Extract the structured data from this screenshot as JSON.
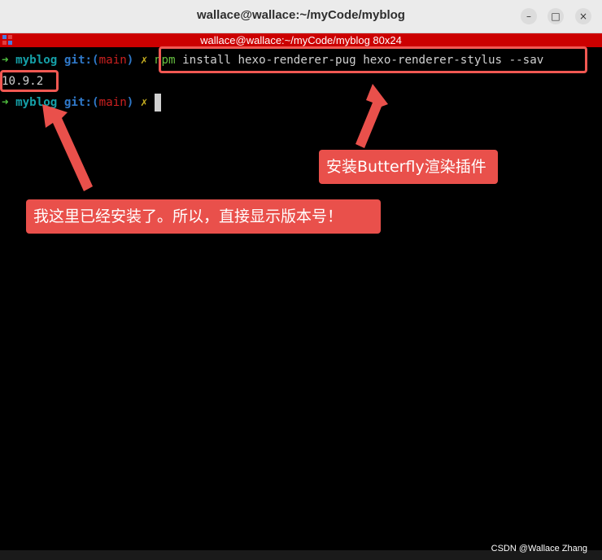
{
  "window": {
    "title": "wallace@wallace:~/myCode/myblog",
    "minimize_glyph": "–",
    "maximize_glyph": "□",
    "close_glyph": "×"
  },
  "tab": {
    "title": "wallace@wallace:~/myCode/myblog 80x24"
  },
  "terminal": {
    "line1": {
      "arrow": "➜",
      "dir": "myblog",
      "git_prefix": "git:(",
      "branch": "main",
      "git_suffix": ")",
      "dirty": "✗",
      "cmd": "npm",
      "args": "install hexo-renderer-pug hexo-renderer-stylus --sav"
    },
    "line2": {
      "output": "10.9.2"
    },
    "line3": {
      "arrow": "➜",
      "dir": "myblog",
      "git_prefix": "git:(",
      "branch": "main",
      "git_suffix": ")",
      "dirty": "✗"
    }
  },
  "annotations": {
    "callout_install": "安装Butterfly渲染插件",
    "callout_version": "我这里已经安装了。所以，直接显示版本号！"
  },
  "watermark": "CSDN @Wallace Zhang",
  "colors": {
    "annotation_red": "#e9504b",
    "tab_red": "#cc0000",
    "prompt_green": "#4fbf3f",
    "dir_cyan": "#15a0a8",
    "git_blue": "#2f78c8"
  }
}
